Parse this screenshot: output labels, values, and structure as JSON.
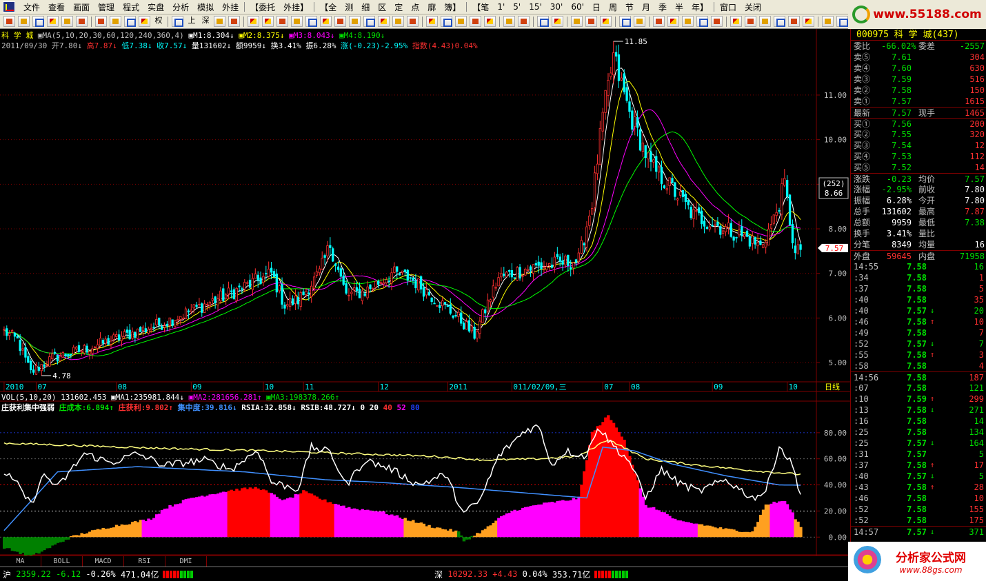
{
  "menu": [
    "文件",
    "查看",
    "画面",
    "管理",
    "程式",
    "实盘",
    "分析",
    "模拟",
    "外挂",
    "【委托",
    "外挂】",
    "【全",
    "测",
    "细",
    "区",
    "定",
    "点",
    "廓",
    "簿】",
    "【笔",
    "1'",
    "5'",
    "15'",
    "30'",
    "60'",
    "日",
    "周",
    "节",
    "月",
    "季",
    "半",
    "年】",
    "窗口",
    "关闭"
  ],
  "brand_top": "www.55188.com",
  "toolbar_text": {
    "quan": "权",
    "shang": "上",
    "shen": "深"
  },
  "main_legend": {
    "stock": "科 学 城",
    "ma_params": "MA(5,10,20,30,60,120,240,360,4)",
    "m1": "1:8.304",
    "m2": "2:8.375",
    "m3": "3:8.043",
    "m4": "4:8.190"
  },
  "bar_info": {
    "date": "2011/09/30",
    "open_label": "开",
    "open": "7.80",
    "high_label": "高",
    "high": "7.87",
    "low_label": "低",
    "low": "7.38",
    "close_label": "收",
    "close": "7.57",
    "vol_label": "量",
    "vol": "131602",
    "amt_label": "额",
    "amt": "9959",
    "turn_label": "换",
    "turn": "3.41%",
    "amp_label": "振",
    "amp": "6.28%",
    "chg_label": "涨",
    "chg": "(-0.23)-2.95%",
    "idx_label": "指数",
    "idx": "(4.43)0.04%"
  },
  "price_axis": {
    "ticks": [
      {
        "v": 11.0,
        "t": "11.00"
      },
      {
        "v": 10.0,
        "t": "10.00"
      },
      {
        "v": 9.0,
        "t": "9.00"
      },
      {
        "v": 8.0,
        "t": "8.00"
      },
      {
        "v": 7.0,
        "t": "7.00"
      },
      {
        "v": 6.0,
        "t": "6.00"
      },
      {
        "v": 5.0,
        "t": "5.00"
      }
    ],
    "cursor_box_top": "(252)",
    "cursor_box_bottom": "8.66",
    "last_price": "7.57",
    "max_label": "11.85",
    "min_label": "4.78"
  },
  "time_axis": [
    {
      "t": "2010",
      "i": 0
    },
    {
      "t": "07",
      "i": 12
    },
    {
      "t": "08",
      "i": 42
    },
    {
      "t": "09",
      "i": 70
    },
    {
      "t": "10",
      "i": 97
    },
    {
      "t": "11",
      "i": 112
    },
    {
      "t": "12",
      "i": 140
    },
    {
      "t": "2011",
      "i": 166
    },
    {
      "t": "011/02/09,三",
      "i": 190
    },
    {
      "t": "07",
      "i": 224
    },
    {
      "t": "08",
      "i": 234
    },
    {
      "t": "09",
      "i": 265
    },
    {
      "t": "10",
      "i": 293
    }
  ],
  "period_label": "日线",
  "vol_legend": {
    "name": "VOL(5,10,20)",
    "v": "131602.453",
    "ma1": "MA1:235981.844",
    "ma2": "MA2:281656.281",
    "ma3": "MA3:198378.266"
  },
  "ind_legend": {
    "name": "庄获利集中强弱",
    "cost": "庄成本:6.894",
    "profit": "庄获利:9.802",
    "conc": "集中度:39.816",
    "rsia": "RSIA:32.858",
    "rsib": "RSIB:48.727",
    "n1": "0",
    "n2": "20",
    "n3": "40",
    "n4": "52",
    "n5": "80"
  },
  "ind_axis": [
    {
      "v": 80,
      "t": "80.00"
    },
    {
      "v": 60,
      "t": "60.00"
    },
    {
      "v": 40,
      "t": "40.00"
    },
    {
      "v": 20,
      "t": "20.00"
    },
    {
      "v": 0,
      "t": "0.00"
    }
  ],
  "bottom_tabs": [
    "MA",
    "BOLL",
    "MACD",
    "RSI",
    "DMI"
  ],
  "quote": {
    "title": "000975 科 学 城(437)",
    "weibi_k": "委比",
    "weibi": "-66.02%",
    "weicha_k": "委差",
    "weicha": "-2557",
    "asks": [
      {
        "k": "卖⑤",
        "p": "7.61",
        "v": "304"
      },
      {
        "k": "卖④",
        "p": "7.60",
        "v": "630"
      },
      {
        "k": "卖③",
        "p": "7.59",
        "v": "516"
      },
      {
        "k": "卖②",
        "p": "7.58",
        "v": "150"
      },
      {
        "k": "卖①",
        "p": "7.57",
        "v": "1615"
      }
    ],
    "last_k": "最新",
    "last": "7.57",
    "xs_k": "现手",
    "xs": "1465",
    "bids": [
      {
        "k": "买①",
        "p": "7.56",
        "v": "200"
      },
      {
        "k": "买②",
        "p": "7.55",
        "v": "320"
      },
      {
        "k": "买③",
        "p": "7.54",
        "v": "12"
      },
      {
        "k": "买④",
        "p": "7.53",
        "v": "112"
      },
      {
        "k": "买⑤",
        "p": "7.52",
        "v": "14"
      }
    ],
    "stats": [
      {
        "k": "涨跌",
        "v": "-0.23",
        "vc": "green",
        "k2": "均价",
        "v2": "7.57",
        "v2c": "green"
      },
      {
        "k": "涨幅",
        "v": "-2.95%",
        "vc": "green",
        "k2": "前收",
        "v2": "7.80",
        "v2c": "white"
      },
      {
        "k": "振幅",
        "v": "6.28%",
        "vc": "white",
        "k2": "今开",
        "v2": "7.80",
        "v2c": "white"
      },
      {
        "k": "总手",
        "v": "131602",
        "vc": "white",
        "k2": "最高",
        "v2": "7.87",
        "v2c": "red"
      },
      {
        "k": "总额",
        "v": "9959",
        "vc": "white",
        "k2": "最低",
        "v2": "7.38",
        "v2c": "green"
      },
      {
        "k": "换手",
        "v": "3.41%",
        "vc": "white",
        "k2": "量比",
        "v2": "",
        "v2c": "white"
      },
      {
        "k": "分笔",
        "v": "8349",
        "vc": "white",
        "k2": "均量",
        "v2": "16",
        "v2c": "white"
      }
    ],
    "outer_k": "外盘",
    "outer": "59645",
    "inner_k": "内盘",
    "inner": "71958",
    "ticks": [
      {
        "t": "14:55",
        "p": "7.58",
        "a": "",
        "v": "16",
        "c": "green",
        "h": false
      },
      {
        "t": ":34",
        "p": "7.58",
        "a": "",
        "v": "1",
        "c": "red",
        "h": false
      },
      {
        "t": ":37",
        "p": "7.58",
        "a": "",
        "v": "5",
        "c": "red",
        "h": false
      },
      {
        "t": ":40",
        "p": "7.58",
        "a": "",
        "v": "35",
        "c": "red",
        "h": false
      },
      {
        "t": ":40",
        "p": "7.57",
        "a": "↓",
        "v": "20",
        "c": "green",
        "h": false
      },
      {
        "t": ":46",
        "p": "7.58",
        "a": "↑",
        "v": "10",
        "c": "red",
        "h": false
      },
      {
        "t": ":49",
        "p": "7.58",
        "a": "",
        "v": "7",
        "c": "red",
        "h": false
      },
      {
        "t": ":52",
        "p": "7.57",
        "a": "↓",
        "v": "7",
        "c": "green",
        "h": false
      },
      {
        "t": ":55",
        "p": "7.58",
        "a": "↑",
        "v": "3",
        "c": "red",
        "h": false
      },
      {
        "t": ":58",
        "p": "7.58",
        "a": "",
        "v": "4",
        "c": "red",
        "h": false
      },
      {
        "t": "14:56",
        "p": "7.58",
        "a": "",
        "v": "187",
        "c": "red",
        "h": true
      },
      {
        "t": ":07",
        "p": "7.58",
        "a": "",
        "v": "121",
        "c": "green",
        "h": false
      },
      {
        "t": ":10",
        "p": "7.59",
        "a": "↑",
        "v": "299",
        "c": "red",
        "h": false
      },
      {
        "t": ":13",
        "p": "7.58",
        "a": "↓",
        "v": "271",
        "c": "green",
        "h": false
      },
      {
        "t": ":16",
        "p": "7.58",
        "a": "",
        "v": "14",
        "c": "green",
        "h": false
      },
      {
        "t": ":25",
        "p": "7.58",
        "a": "",
        "v": "134",
        "c": "green",
        "h": false
      },
      {
        "t": ":25",
        "p": "7.57",
        "a": "↓",
        "v": "164",
        "c": "green",
        "h": false
      },
      {
        "t": ":31",
        "p": "7.57",
        "a": "",
        "v": "5",
        "c": "green",
        "h": false
      },
      {
        "t": ":37",
        "p": "7.58",
        "a": "↑",
        "v": "17",
        "c": "red",
        "h": false
      },
      {
        "t": ":40",
        "p": "7.57",
        "a": "↓",
        "v": "5",
        "c": "green",
        "h": false
      },
      {
        "t": ":43",
        "p": "7.58",
        "a": "↑",
        "v": "28",
        "c": "red",
        "h": false
      },
      {
        "t": ":46",
        "p": "7.58",
        "a": "",
        "v": "10",
        "c": "red",
        "h": false
      },
      {
        "t": ":52",
        "p": "7.58",
        "a": "",
        "v": "155",
        "c": "red",
        "h": false
      },
      {
        "t": ":52",
        "p": "7.58",
        "a": "",
        "v": "175",
        "c": "red",
        "h": false
      },
      {
        "t": "14:57",
        "p": "7.57",
        "a": "↓",
        "v": "371",
        "c": "green",
        "h": true
      }
    ]
  },
  "status": {
    "sh_name": "沪",
    "sh_idx": "2359.22",
    "sh_chg": "-6.12",
    "sh_pct": "-0.26%",
    "sh_amt": "471.04亿",
    "sz_name": "深",
    "sz_idx": "10292.33",
    "sz_chg": "+4.43",
    "sz_pct": "0.04%",
    "sz_amt": "353.71亿"
  },
  "brand_bottom": {
    "name": "分析家公式网",
    "url": "www.88gs.com"
  },
  "colors": {
    "up": "#ff3030",
    "down": "#00ffff",
    "ma5": "#ffffff",
    "ma10": "#ffff00",
    "ma20": "#ff00ff",
    "ma30": "#00ff00",
    "axis": "#800000",
    "grid": "#800000",
    "ind_red": "#ff0000",
    "ind_mag": "#ff00ff",
    "ind_orange": "#ffa020",
    "ind_green": "#008000",
    "ind_blue": "#4090ff",
    "ind_yellow": "#ffff80"
  },
  "chart_data": {
    "type": "candlestick",
    "anchors": [
      [
        0,
        5.7
      ],
      [
        5,
        5.5
      ],
      [
        10,
        4.78
      ],
      [
        18,
        5.1
      ],
      [
        30,
        5.3
      ],
      [
        45,
        5.6
      ],
      [
        60,
        5.9
      ],
      [
        75,
        6.3
      ],
      [
        90,
        6.7
      ],
      [
        100,
        7.0
      ],
      [
        105,
        6.3
      ],
      [
        110,
        6.4
      ],
      [
        118,
        7.0
      ],
      [
        122,
        7.65
      ],
      [
        128,
        6.5
      ],
      [
        135,
        6.6
      ],
      [
        145,
        7.0
      ],
      [
        152,
        6.9
      ],
      [
        162,
        6.4
      ],
      [
        170,
        6.0
      ],
      [
        176,
        5.62
      ],
      [
        185,
        6.9
      ],
      [
        195,
        7.1
      ],
      [
        205,
        7.2
      ],
      [
        215,
        7.3
      ],
      [
        220,
        8.6
      ],
      [
        224,
        10.5
      ],
      [
        228,
        11.85
      ],
      [
        234,
        10.6
      ],
      [
        242,
        9.4
      ],
      [
        250,
        8.9
      ],
      [
        258,
        8.3
      ],
      [
        270,
        8.0
      ],
      [
        278,
        7.8
      ],
      [
        283,
        7.6
      ],
      [
        288,
        8.2
      ],
      [
        292,
        9.0
      ],
      [
        296,
        7.4
      ],
      [
        298,
        7.57
      ]
    ],
    "volatility": 0.12,
    "ind_conc_anchors": [
      [
        0,
        5
      ],
      [
        20,
        50
      ],
      [
        50,
        54
      ],
      [
        90,
        50
      ],
      [
        120,
        44
      ],
      [
        140,
        42
      ],
      [
        170,
        38
      ],
      [
        200,
        33
      ],
      [
        218,
        30
      ],
      [
        224,
        69
      ],
      [
        236,
        66
      ],
      [
        250,
        56
      ],
      [
        270,
        47
      ],
      [
        290,
        40
      ],
      [
        298,
        39.8
      ]
    ],
    "ind_cost_anchors": [
      [
        0,
        72
      ],
      [
        30,
        70
      ],
      [
        60,
        68
      ],
      [
        100,
        66
      ],
      [
        130,
        64
      ],
      [
        160,
        62
      ],
      [
        180,
        59
      ],
      [
        200,
        60
      ],
      [
        215,
        62
      ],
      [
        226,
        75
      ],
      [
        240,
        60
      ],
      [
        260,
        55
      ],
      [
        280,
        51
      ],
      [
        298,
        48
      ]
    ],
    "ind_rsi_anchors": [
      [
        0,
        50
      ],
      [
        5,
        40
      ],
      [
        10,
        25
      ],
      [
        15,
        48
      ],
      [
        20,
        38
      ],
      [
        30,
        64
      ],
      [
        40,
        57
      ],
      [
        50,
        64
      ],
      [
        60,
        55
      ],
      [
        75,
        59
      ],
      [
        85,
        52
      ],
      [
        95,
        67
      ],
      [
        100,
        42
      ],
      [
        110,
        37
      ],
      [
        115,
        69
      ],
      [
        122,
        65
      ],
      [
        128,
        40
      ],
      [
        135,
        59
      ],
      [
        145,
        52
      ],
      [
        155,
        40
      ],
      [
        165,
        48
      ],
      [
        172,
        18
      ],
      [
        178,
        28
      ],
      [
        185,
        62
      ],
      [
        195,
        82
      ],
      [
        200,
        85
      ],
      [
        205,
        55
      ],
      [
        210,
        66
      ],
      [
        218,
        62
      ],
      [
        222,
        85
      ],
      [
        228,
        70
      ],
      [
        234,
        58
      ],
      [
        240,
        30
      ],
      [
        246,
        52
      ],
      [
        252,
        42
      ],
      [
        260,
        35
      ],
      [
        270,
        44
      ],
      [
        280,
        30
      ],
      [
        285,
        35
      ],
      [
        290,
        70
      ],
      [
        295,
        55
      ],
      [
        298,
        32.9
      ]
    ],
    "ind_hist_anchors": [
      [
        0,
        -8
      ],
      [
        10,
        -15
      ],
      [
        20,
        -5
      ],
      [
        25,
        0
      ],
      [
        30,
        3
      ],
      [
        40,
        8
      ],
      [
        55,
        14
      ],
      [
        60,
        22
      ],
      [
        70,
        30
      ],
      [
        85,
        36
      ],
      [
        95,
        38
      ],
      [
        105,
        28
      ],
      [
        112,
        35
      ],
      [
        120,
        28
      ],
      [
        130,
        22
      ],
      [
        140,
        20
      ],
      [
        150,
        14
      ],
      [
        160,
        8
      ],
      [
        170,
        4
      ],
      [
        172,
        -3
      ],
      [
        180,
        6
      ],
      [
        185,
        14
      ],
      [
        190,
        20
      ],
      [
        200,
        25
      ],
      [
        210,
        28
      ],
      [
        215,
        30
      ],
      [
        220,
        80
      ],
      [
        226,
        93
      ],
      [
        232,
        75
      ],
      [
        240,
        24
      ],
      [
        246,
        20
      ],
      [
        252,
        12
      ],
      [
        260,
        10
      ],
      [
        270,
        6
      ],
      [
        280,
        4
      ],
      [
        285,
        25
      ],
      [
        292,
        28
      ],
      [
        298,
        8
      ]
    ],
    "ind_hist_colors": [
      [
        0,
        "green"
      ],
      [
        25,
        "orange"
      ],
      [
        52,
        "magenta"
      ],
      [
        84,
        "red"
      ],
      [
        100,
        "magenta"
      ],
      [
        111,
        "red"
      ],
      [
        124,
        "magenta"
      ],
      [
        150,
        "orange"
      ],
      [
        170,
        "green"
      ],
      [
        176,
        "orange"
      ],
      [
        185,
        "magenta"
      ],
      [
        216,
        "red"
      ],
      [
        238,
        "magenta"
      ],
      [
        260,
        "orange"
      ],
      [
        287,
        "magenta"
      ],
      [
        296,
        "orange"
      ]
    ]
  }
}
